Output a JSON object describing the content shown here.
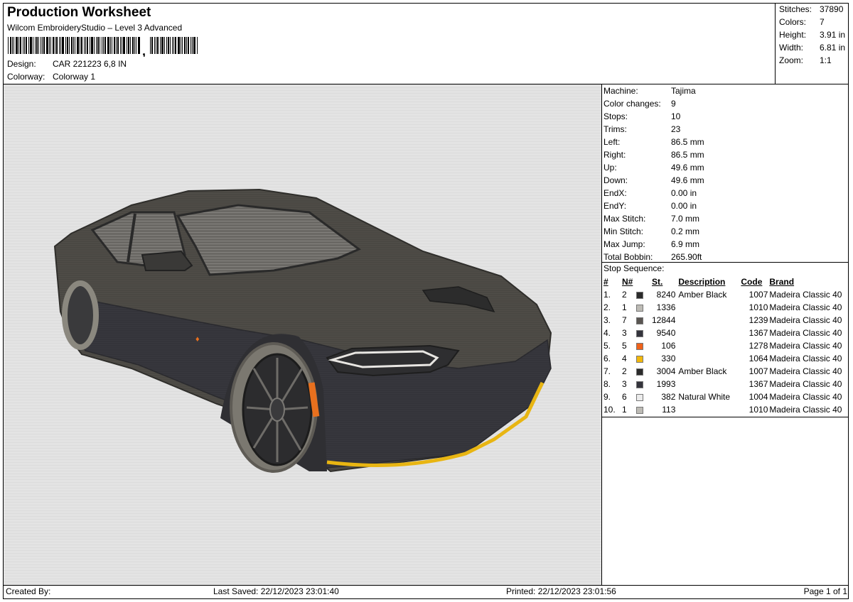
{
  "header": {
    "title": "Production Worksheet",
    "subtitle": "Wilcom EmbroideryStudio – Level 3 Advanced",
    "barcode_icon": "barcode-icon",
    "design_label": "Design:",
    "design_value": "CAR 221223 6,8 IN",
    "colorway_label": "Colorway:",
    "colorway_value": "Colorway 1"
  },
  "summary": [
    {
      "label": "Stitches:",
      "value": "37890"
    },
    {
      "label": "Colors:",
      "value": "7"
    },
    {
      "label": "Height:",
      "value": "3.91 in"
    },
    {
      "label": "Width:",
      "value": "6.81 in"
    },
    {
      "label": "Zoom:",
      "value": "1:1"
    }
  ],
  "machine_info": [
    {
      "label": "Machine:",
      "value": "Tajima"
    },
    {
      "label": "Color changes:",
      "value": "9"
    },
    {
      "label": "Stops:",
      "value": "10"
    },
    {
      "label": "Trims:",
      "value": "23"
    },
    {
      "label": "Left:",
      "value": "86.5 mm"
    },
    {
      "label": "Right:",
      "value": "86.5 mm"
    },
    {
      "label": "Up:",
      "value": "49.6 mm"
    },
    {
      "label": "Down:",
      "value": "49.6 mm"
    },
    {
      "label": "EndX:",
      "value": "0.00 in"
    },
    {
      "label": "EndY:",
      "value": "0.00 in"
    },
    {
      "label": "Max Stitch:",
      "value": "7.0 mm"
    },
    {
      "label": "Min Stitch:",
      "value": "0.2 mm"
    },
    {
      "label": "Max Jump:",
      "value": "6.9 mm"
    },
    {
      "label": "Total Bobbin:",
      "value": "265.90ft"
    }
  ],
  "stop_sequence": {
    "caption": "Stop Sequence:",
    "headers": {
      "index": "#",
      "n": "N#",
      "st": "St.",
      "description": "Description",
      "code": "Code",
      "brand": "Brand"
    },
    "rows": [
      {
        "index": "1.",
        "n": "2",
        "color": "#2b2b2b",
        "st": "8240",
        "description": "Amber Black",
        "code": "1007",
        "brand": "Madeira Classic 40"
      },
      {
        "index": "2.",
        "n": "1",
        "color": "#bdbbb5",
        "st": "1336",
        "description": "",
        "code": "1010",
        "brand": "Madeira Classic 40"
      },
      {
        "index": "3.",
        "n": "7",
        "color": "#5a5652",
        "st": "12844",
        "description": "",
        "code": "1239",
        "brand": "Madeira Classic 40"
      },
      {
        "index": "4.",
        "n": "3",
        "color": "#34343c",
        "st": "9540",
        "description": "",
        "code": "1367",
        "brand": "Madeira Classic 40"
      },
      {
        "index": "5.",
        "n": "5",
        "color": "#f0621a",
        "st": "106",
        "description": "",
        "code": "1278",
        "brand": "Madeira Classic 40"
      },
      {
        "index": "6.",
        "n": "4",
        "color": "#f2b80c",
        "st": "330",
        "description": "",
        "code": "1064",
        "brand": "Madeira Classic 40"
      },
      {
        "index": "7.",
        "n": "2",
        "color": "#2b2b2b",
        "st": "3004",
        "description": "Amber Black",
        "code": "1007",
        "brand": "Madeira Classic 40"
      },
      {
        "index": "8.",
        "n": "3",
        "color": "#34343c",
        "st": "1993",
        "description": "",
        "code": "1367",
        "brand": "Madeira Classic 40"
      },
      {
        "index": "9.",
        "n": "6",
        "color": "#ececec",
        "st": "382",
        "description": "Natural White",
        "code": "1004",
        "brand": "Madeira Classic 40"
      },
      {
        "index": "10.",
        "n": "1",
        "color": "#bdbbb5",
        "st": "113",
        "description": "",
        "code": "1010",
        "brand": "Madeira Classic 40"
      }
    ]
  },
  "design_preview": {
    "icon": "car-embroidery-image"
  },
  "footer": {
    "created_by": "Created By:",
    "last_saved": "Last Saved: 22/12/2023 23:01:40",
    "printed": "Printed: 22/12/2023 23:01:56",
    "page": "Page 1 of 1"
  }
}
